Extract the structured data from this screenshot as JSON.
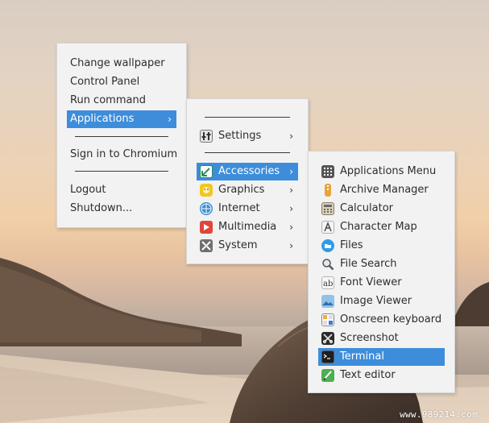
{
  "main_menu": {
    "items": [
      {
        "label": "Change wallpaper"
      },
      {
        "label": "Control Panel"
      },
      {
        "label": "Run command"
      },
      {
        "label": "Applications",
        "arrow": "›"
      },
      {
        "label": "Sign in to Chromium"
      },
      {
        "label": "Logout"
      },
      {
        "label": "Shutdown..."
      }
    ]
  },
  "applications_menu": {
    "items": [
      {
        "label": "Settings",
        "arrow": "›",
        "icon": "settings-icon"
      },
      {
        "label": "Accessories",
        "arrow": "›",
        "icon": "accessories-icon"
      },
      {
        "label": "Graphics",
        "arrow": "›",
        "icon": "graphics-icon"
      },
      {
        "label": "Internet",
        "arrow": "›",
        "icon": "internet-icon"
      },
      {
        "label": "Multimedia",
        "arrow": "›",
        "icon": "multimedia-icon"
      },
      {
        "label": "System",
        "arrow": "›",
        "icon": "system-icon"
      }
    ]
  },
  "accessories_menu": {
    "items": [
      {
        "label": "Applications Menu",
        "icon": "grid-icon"
      },
      {
        "label": "Archive Manager",
        "icon": "archive-icon"
      },
      {
        "label": "Calculator",
        "icon": "calculator-icon"
      },
      {
        "label": "Character Map",
        "icon": "character-map-icon"
      },
      {
        "label": "Files",
        "icon": "folder-icon"
      },
      {
        "label": "File Search",
        "icon": "magnifier-icon"
      },
      {
        "label": "Font Viewer",
        "icon": "font-icon"
      },
      {
        "label": "Image Viewer",
        "icon": "image-icon"
      },
      {
        "label": "Onscreen keyboard",
        "icon": "keyboard-icon"
      },
      {
        "label": "Screenshot",
        "icon": "screenshot-icon"
      },
      {
        "label": "Terminal",
        "icon": "terminal-icon"
      },
      {
        "label": "Text editor",
        "icon": "text-editor-icon"
      }
    ]
  },
  "watermark": "www.989214.com",
  "colors": {
    "selection": "#3d8ddb",
    "menu_bg": "#f2f2f2",
    "text": "#2d2d2d"
  }
}
